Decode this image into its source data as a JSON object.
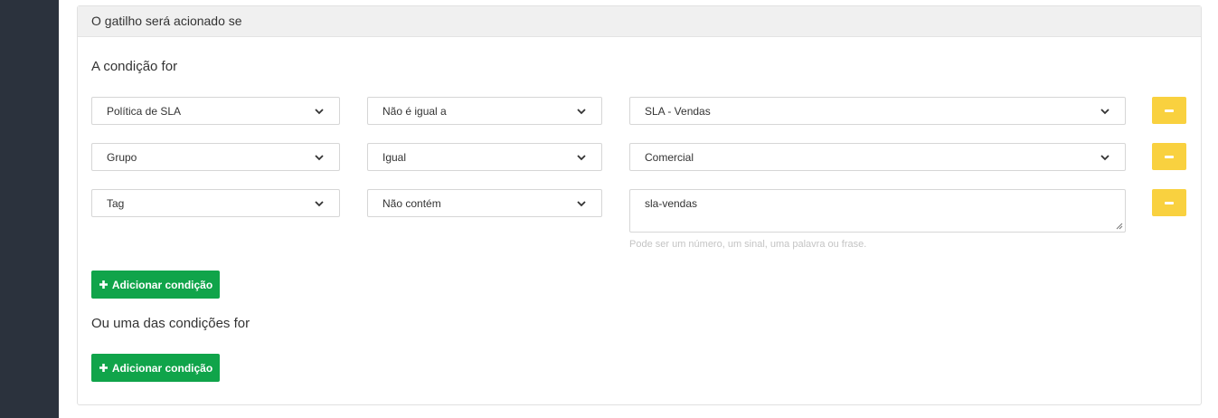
{
  "panel": {
    "heading": "O gatilho será acionado se",
    "all_conditions_title": "A condição for",
    "any_conditions_title": "Ou uma das condições for"
  },
  "conditions": [
    {
      "field": "Política de SLA",
      "operator": "Não é igual a",
      "value": "SLA - Vendas",
      "value_type": "select"
    },
    {
      "field": "Grupo",
      "operator": "Igual",
      "value": "Comercial",
      "value_type": "select"
    },
    {
      "field": "Tag",
      "operator": "Não contém",
      "value": "sla-vendas",
      "value_type": "textarea",
      "help": "Pode ser um número, um sinal, uma palavra ou frase."
    }
  ],
  "buttons": {
    "add_condition": "Adicionar condição",
    "add_any_condition": "Adicionar condição"
  },
  "icons": {
    "dropdown": "chevron-down-icon",
    "remove": "minus-icon",
    "add": "plus-icon",
    "resize": "resize-grip-icon"
  },
  "colors": {
    "sidebar": "#2b323d",
    "remove_button": "#f9d13f",
    "add_button": "#10a44a",
    "help_text": "#c4c4c4"
  }
}
